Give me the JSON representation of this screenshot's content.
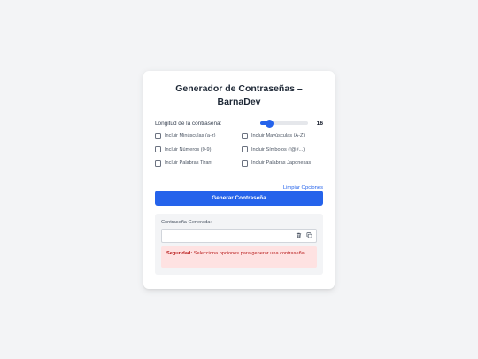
{
  "card": {
    "title": "Generador de Contraseñas – BarnaDev"
  },
  "length": {
    "label": "Longitud de la contraseña:",
    "value": "16",
    "min": 4,
    "max": 64,
    "fraction": 0.19
  },
  "options": [
    {
      "label": "Incluir Minúsculas (a-z)",
      "checked": false
    },
    {
      "label": "Incluir Mayúsculas (A-Z)",
      "checked": false
    },
    {
      "label": "Incluir Números (0-9)",
      "checked": false
    },
    {
      "label": "Incluir Símbolos (!@#...)",
      "checked": false
    },
    {
      "label": "Incluir Palabras Tirant",
      "checked": false
    },
    {
      "label": "Incluir Palabras Japonesas",
      "checked": false
    }
  ],
  "clear_label": "Limpiar Opciones",
  "generate_label": "Generar Contraseña",
  "result": {
    "label": "Contraseña Generada:",
    "value": "",
    "alert_strong": "Seguridad:",
    "alert_text": " Selecciona opciones para generar una contraseña."
  },
  "icons": {
    "delete": "trash-icon",
    "copy": "copy-icon"
  },
  "colors": {
    "accent": "#2563eb",
    "background": "#f3f4f6",
    "alert_bg": "#fee2e2",
    "alert_text": "#b91c1c"
  }
}
